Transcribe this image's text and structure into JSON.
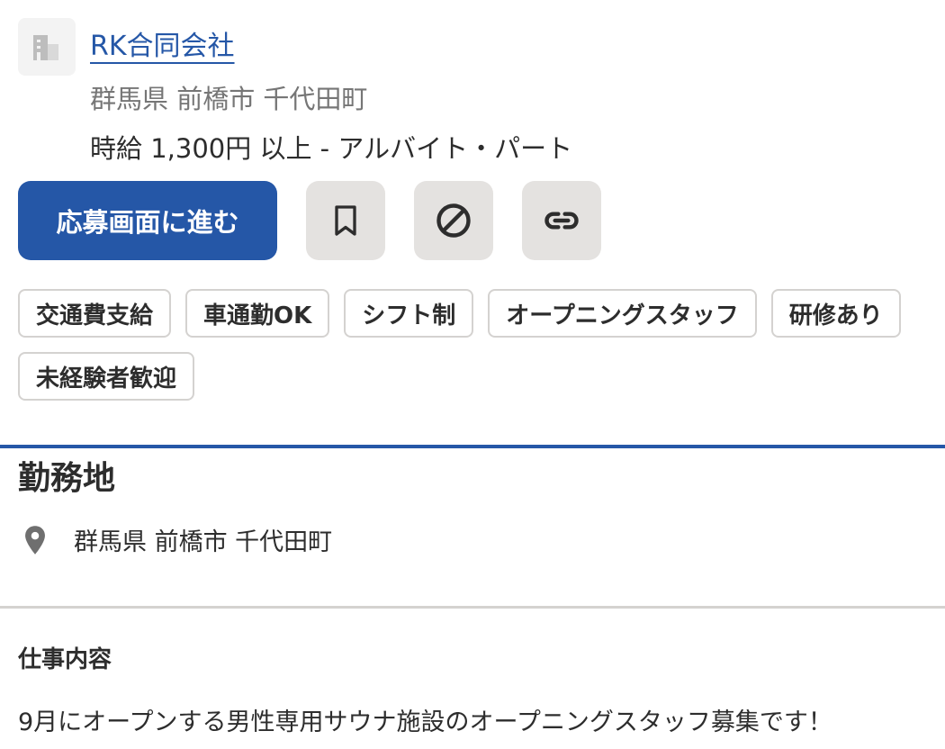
{
  "company": {
    "name": "RK合同会社",
    "location": "群馬県 前橋市 千代田町",
    "salary": "時給 1,300円 以上 - アルバイト・パート"
  },
  "actions": {
    "apply_label": "応募画面に進む",
    "save_icon": "bookmark-icon",
    "block_icon": "not-interested-icon",
    "link_icon": "link-icon"
  },
  "tags": [
    "交通費支給",
    "車通勤OK",
    "シフト制",
    "オープニングスタッフ",
    "研修あり",
    "未経験者歓迎"
  ],
  "work_location": {
    "title": "勤務地",
    "address": "群馬県 前橋市 千代田町"
  },
  "job_content": {
    "title": "仕事内容",
    "description": "9月にオープンする男性専用サウナ施設のオープニングスタッフ募集です！"
  },
  "colors": {
    "accent": "#2557a7",
    "muted_text": "#767676",
    "icon_button_bg": "#e4e2e0",
    "border": "#d4d2d0"
  }
}
